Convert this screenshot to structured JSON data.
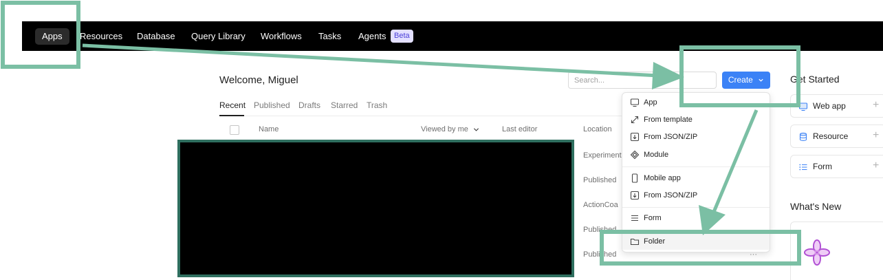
{
  "nav": {
    "items": [
      {
        "label": "Apps",
        "active": true
      },
      {
        "label": "Resources"
      },
      {
        "label": "Database"
      },
      {
        "label": "Query Library"
      },
      {
        "label": "Workflows"
      },
      {
        "label": "Tasks"
      },
      {
        "label": "Agents"
      }
    ],
    "badge": "Beta"
  },
  "header": {
    "welcome": "Welcome, Miguel",
    "search_placeholder": "Search...",
    "create_label": "Create",
    "create_icon": "chevron-down-icon",
    "accent_color": "#3b82f6"
  },
  "tabs": [
    "Recent",
    "Published",
    "Drafts",
    "Starred",
    "Trash"
  ],
  "table": {
    "columns": [
      "Name",
      "Viewed by me",
      "Last editor",
      "Location"
    ],
    "sort_column": "Viewed by me",
    "locations": [
      "Experiment",
      "Published",
      "ActionCoa",
      "Published",
      "Published"
    ],
    "row_menu": "···"
  },
  "create_menu": {
    "groups": [
      [
        {
          "label": "App",
          "icon": "monitor-icon"
        },
        {
          "label": "From template",
          "icon": "expand-arrows-icon"
        },
        {
          "label": "From JSON/ZIP",
          "icon": "import-icon"
        },
        {
          "label": "Module",
          "icon": "module-icon"
        }
      ],
      [
        {
          "label": "Mobile app",
          "icon": "mobile-icon"
        },
        {
          "label": "From JSON/ZIP",
          "icon": "import-icon"
        }
      ],
      [
        {
          "label": "Form",
          "icon": "form-lines-icon"
        }
      ],
      [
        {
          "label": "Folder",
          "icon": "folder-icon",
          "hovered": true
        }
      ]
    ]
  },
  "sidebar": {
    "get_started_title": "Get Started",
    "cards": [
      {
        "label": "Web app",
        "icon": "monitor-icon"
      },
      {
        "label": "Resource",
        "icon": "database-icon"
      },
      {
        "label": "Form",
        "icon": "list-icon"
      }
    ],
    "plus": "+",
    "whats_new_title": "What's New"
  },
  "annotation": {
    "color": "#7bbfa4"
  }
}
